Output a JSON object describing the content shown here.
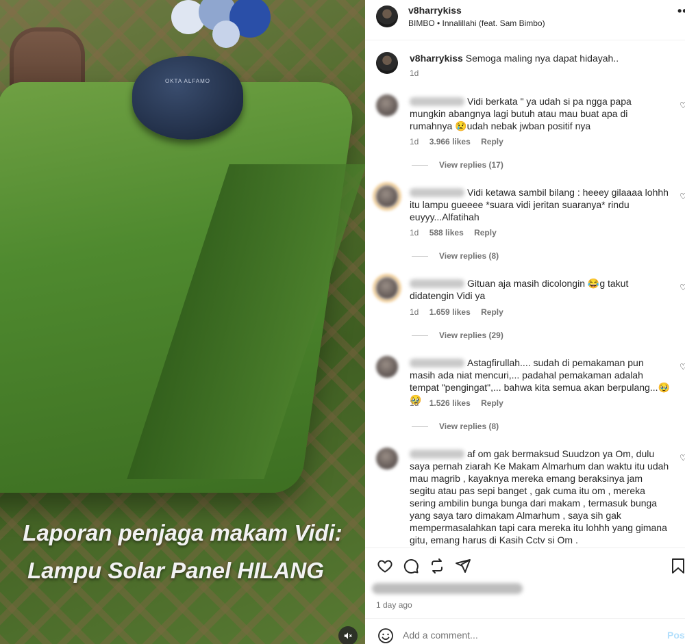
{
  "media": {
    "caption_line1": "Laporan penjaga makam Vidi:",
    "caption_line2": "Lampu Solar Panel HILANG",
    "plaque_text": "OKTA ALFAMO",
    "mute_icon": "speaker-muted-icon"
  },
  "header": {
    "username": "v8harrykiss",
    "audio": "BIMBO • Innalillahi (feat. Sam Bimbo)",
    "more_icon": "more-horizontal-icon"
  },
  "caption": {
    "username": "v8harrykiss",
    "text": "Semoga maling nya dapat hidayah..",
    "time": "1d"
  },
  "comments": [
    {
      "text": "Vidi berkata \" ya udah si pa ngga papa mungkin abangnya lagi butuh atau mau buat apa di rumahnya 😢udah nebak jwban positif nya",
      "time": "1d",
      "likes": "3.966 likes",
      "reply": "Reply",
      "view_replies": "View replies (17)"
    },
    {
      "text": "Vidi ketawa sambil bilang : heeey gilaaaa lohhh itu lampu gueeee *suara vidi jeritan suaranya* rindu euyyy...Alfatihah",
      "time": "1d",
      "likes": "588 likes",
      "reply": "Reply",
      "view_replies": "View replies (8)"
    },
    {
      "text": "Gituan aja masih dicolongin 😂g takut didatengin Vidi ya",
      "time": "1d",
      "likes": "1.659 likes",
      "reply": "Reply",
      "view_replies": "View replies (29)"
    },
    {
      "text": "Astagfirullah.... sudah di pemakaman pun masih ada niat mencuri,... padahal pemakaman adalah tempat \"pengingat\",... bahwa kita semua akan berpulang...🥹🥹",
      "time": "1d",
      "likes": "1.526 likes",
      "reply": "Reply",
      "view_replies": "View replies (8)"
    },
    {
      "text": "af om gak bermaksud Suudzon ya Om, dulu saya pernah ziarah Ke Makam Almarhum dan waktu itu udah mau magrib , kayaknya mereka emang beraksinya jam segitu atau pas sepi banget , gak cuma itu om , mereka sering ambilin bunga bunga dari makam , termasuk bunga yang saya taro dimakam Almarhum , saya sih gak mempermasalahkan tapi cara mereka itu lohhh yang gimana gitu, emang harus di Kasih Cctv si Om ."
    }
  ],
  "actions": {
    "like_icon": "heart-icon",
    "comment_icon": "comment-icon",
    "share_icon": "repost-icon",
    "send_icon": "send-icon",
    "save_icon": "bookmark-icon"
  },
  "post_time": "1 day ago",
  "comment_box": {
    "placeholder": "Add a comment...",
    "post_label": "Post"
  },
  "colors": {
    "text": "#262626",
    "muted": "#737373",
    "post_disabled": "#b2dffc"
  }
}
